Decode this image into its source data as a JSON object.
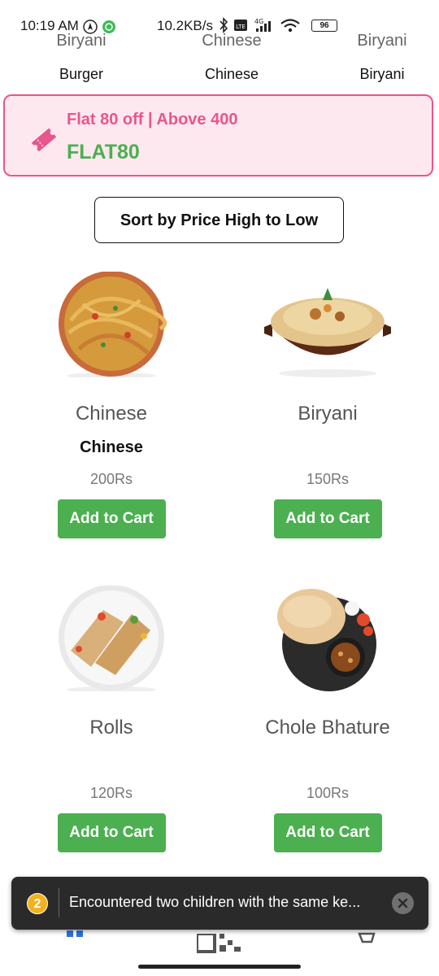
{
  "status_bar": {
    "time": "10:19 AM",
    "network": "10.2KB/s",
    "signal": "4G",
    "battery": "96"
  },
  "categories": [
    {
      "image_text": "Biryani",
      "label": "Burger"
    },
    {
      "image_text": "Chinese",
      "label": "Chinese"
    },
    {
      "image_text": "Biryani",
      "label": "Biryani"
    }
  ],
  "coupon": {
    "offer": "Flat 80 off | Above 400",
    "code": "FLAT80",
    "icon": "ticket-icon"
  },
  "sort_button": "Sort by Price High to Low",
  "products": [
    {
      "image_text": "Chinese",
      "name": "Chinese",
      "price": "200Rs",
      "button": "Add to Cart"
    },
    {
      "image_text": "Biryani",
      "name": "",
      "price": "150Rs",
      "button": "Add to Cart"
    },
    {
      "image_text": "Rolls",
      "name": "",
      "price": "120Rs",
      "button": "Add to Cart"
    },
    {
      "image_text": "Chole Bhature",
      "name": "",
      "price": "100Rs",
      "button": "Add to Cart"
    }
  ],
  "toast": {
    "count": "2",
    "message": "Encountered two children with the same ke..."
  },
  "colors": {
    "accent_green": "#4caf50",
    "coupon_pink": "#e8568c",
    "coupon_bg": "#fde8ef"
  }
}
